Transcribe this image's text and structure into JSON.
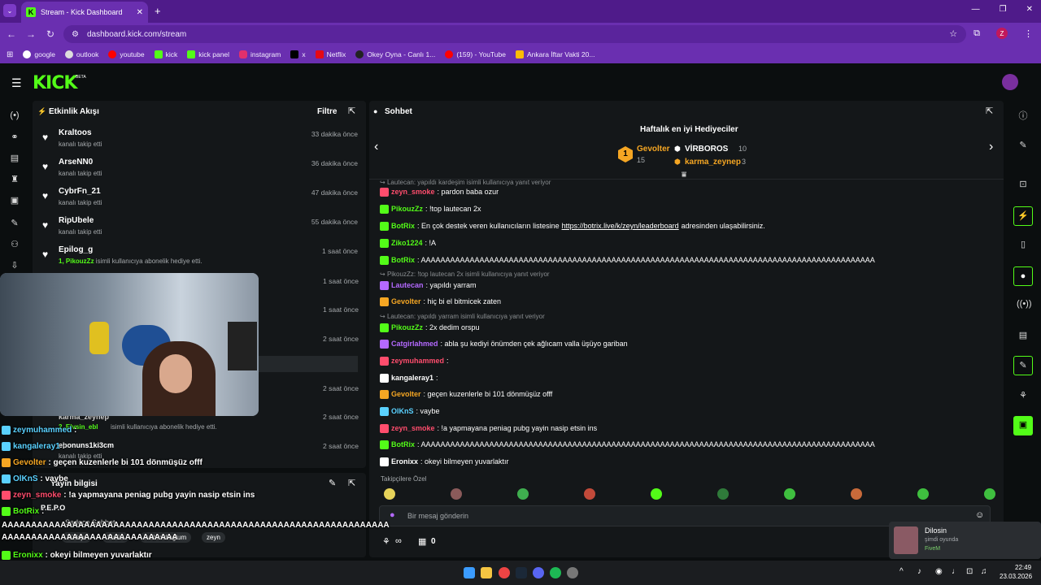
{
  "browser": {
    "tab_title": "Stream - Kick Dashboard",
    "url": "dashboard.kick.com/stream",
    "profile_initial": "Z",
    "bookmarks": [
      "google",
      "outlook",
      "youtube",
      "kick",
      "kick panel",
      "instagram",
      "x",
      "Netflix",
      "Okey Oyna - Canlı 1...",
      "(159) - YouTube",
      "Ankara İftar Vakti 20..."
    ]
  },
  "header": {
    "logo": "KICK",
    "beta": "BETA"
  },
  "activity": {
    "title": "Etkinlik Akışı",
    "filter": "Filtre",
    "events": [
      {
        "name": "Kraltoos",
        "sub": "kanalı takip etti",
        "time": "33 dakika önce"
      },
      {
        "name": "ArseNN0",
        "sub": "kanalı takip etti",
        "time": "36 dakika önce"
      },
      {
        "name": "CybrFn_21",
        "sub": "kanalı takip etti",
        "time": "47 dakika önce"
      },
      {
        "name": "RipUbele",
        "sub": "kanalı takip etti",
        "time": "55 dakika önce"
      },
      {
        "name": "Epilog_g",
        "sub_user": "1, PikouzZz",
        "sub": "isimli kullanıcıya abonelik hediye etti.",
        "time": "1 saat önce"
      }
    ],
    "hidden_times": [
      "1 saat önce",
      "1 saat önce",
      "2 saat önce",
      "2 saat önce",
      "2 saat önce",
      "2 saat önce"
    ],
    "partial_lines": [
      "karma_zeynep",
      "2, Elvsin_ebl",
      "isimli kullanıcıya abonelik hediye etti.",
      "ebonuns1ki3cm",
      "kanalı takip etti"
    ]
  },
  "stream_info": {
    "title": "Yayın bilgisi",
    "rows": [
      "P.E.P.O",
      "Sadece Sohbet",
      "Türkçe",
      "Mafia",
      "kalbimdioğlum",
      "zeyn"
    ]
  },
  "chat": {
    "title": "Sohbet",
    "top_gifters_title": "Haftalık en iyi Hediyeciler",
    "gifters": [
      {
        "rank": "1",
        "name": "Gevolter",
        "count": "15"
      },
      {
        "name": "VİRBOROS",
        "count": "10"
      },
      {
        "name": "karma_zeynep",
        "count": "3"
      }
    ],
    "messages": [
      {
        "reply": "Lautecan: yapıldı kardeşim isimli kullanıcıya yanıt veriyor"
      },
      {
        "user": "zeyn_smoke",
        "color": "#ff4d6d",
        "text": ": pardon baba ozur"
      },
      {
        "user": "PikouzZz",
        "color": "#53fc18",
        "text": ": !top lautecan 2x"
      },
      {
        "user": "BotRix",
        "color": "#53fc18",
        "text": ": En çok destek veren kullanıcıların listesine ",
        "link": "https://botrix.live/k/zeyn/leaderboard",
        "text2": " adresinden ulaşabilirsiniz."
      },
      {
        "user": "Ziko1224",
        "color": "#53fc18",
        "text": ": !A"
      },
      {
        "user": "BotRix",
        "color": "#53fc18",
        "text": ": AAAAAAAAAAAAAAAAAAAAAAAAAAAAAAAAAAAAAAAAAAAAAAAAAAAAAAAAAAAAAAAAAAAAAAAAAAAAAAAAAAAAAAAAAAAAA"
      },
      {
        "reply": "PikouzZz: !top lautecan 2x isimli kullanıcıya yanıt veriyor"
      },
      {
        "user": "Lautecan",
        "color": "#b469ff",
        "text": ": yapıldı yarram"
      },
      {
        "user": "Gevolter",
        "color": "#f5a623",
        "text": ": hiç bi el bitmicek zaten"
      },
      {
        "reply": "Lautecan: yapıldı yarram isimli kullanıcıya yanıt veriyor"
      },
      {
        "user": "PikouzZz",
        "color": "#53fc18",
        "text": ": 2x dedim orspu"
      },
      {
        "user": "Catgirlahmed",
        "color": "#b469ff",
        "text": ": abla şu kediyi önümden çek ağlıcam valla üşüyo gariban"
      },
      {
        "user": "zeymuhammed",
        "color": "#ff4d6d",
        "text": ":"
      },
      {
        "user": "kangaleray1",
        "color": "#ffffff",
        "text": ":"
      },
      {
        "user": "Gevolter",
        "color": "#f5a623",
        "text": ": geçen kuzenlerle bi 101 dönmüşüz offf"
      },
      {
        "user": "OlKnS",
        "color": "#5ad1ff",
        "text": ": vaybe"
      },
      {
        "user": "zeyn_smoke",
        "color": "#ff4d6d",
        "text": ": !a yapmayana peniag pubg yayin nasip etsin ins"
      },
      {
        "user": "BotRix",
        "color": "#53fc18",
        "text": ": AAAAAAAAAAAAAAAAAAAAAAAAAAAAAAAAAAAAAAAAAAAAAAAAAAAAAAAAAAAAAAAAAAAAAAAAAAAAAAAAAAAAAAAAAAAAA"
      },
      {
        "user": "Eronixx",
        "color": "#ffffff",
        "text": ": okeyi bilmeyen yuvarlaktır"
      }
    ],
    "followers_only": "Takipçilere Özel",
    "input_placeholder": "Bir mesaj gönderin",
    "points": "∞",
    "count": "0"
  },
  "overlay_chat": [
    {
      "user": "zeymuhammed",
      "color": "#5ad1ff",
      "text": " :"
    },
    {
      "user": "kangaleray1",
      "color": "#5ad1ff",
      "text": " :"
    },
    {
      "user": "Gevolter",
      "color": "#f5a623",
      "text": " : geçen kuzenlerle bi 101 dönmüşüz offf"
    },
    {
      "user": "OlKnS",
      "color": "#5ad1ff",
      "text": " : vaybe"
    },
    {
      "user": "zeyn_smoke",
      "color": "#ff4d6d",
      "text": " : !a yapmayana peniag pubg yayin nasip etsin ins"
    },
    {
      "user": "BotRix",
      "color": "#53fc18",
      "text": " :"
    },
    {
      "line": "AAAAAAAAAAAAAAAAAAAAAAAAAAAAAAAAAAAAAAAAAAAAAAAAAAAAAAAAAAAAAAAAAA"
    },
    {
      "line": "AAAAAAAAAAAAAAAAAAAAAAAAAAAAAA"
    },
    {
      "user": "Eronixx",
      "color": "#53fc18",
      "text": " : okeyi bilmeyen yuvarlaktır"
    }
  ],
  "toast": {
    "name": "Dilosin",
    "status": "şimdi oyunda",
    "game": "FiveM"
  },
  "taskbar": {
    "time": "22:49",
    "date": "23.03.2026"
  },
  "colors": {
    "accent": "#53fc18",
    "browser": "#6a2fb0",
    "panel": "#141719"
  }
}
